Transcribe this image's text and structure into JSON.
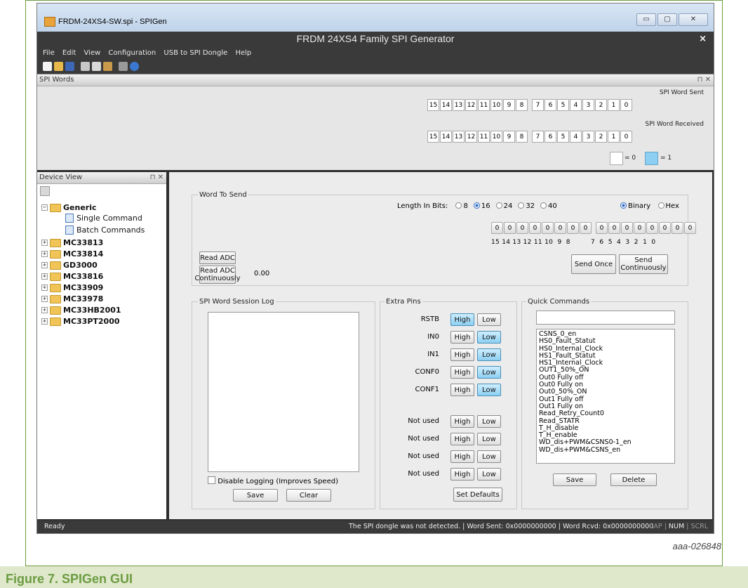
{
  "window": {
    "title": "FRDM-24XS4-SW.spi - SPIGen",
    "app_header": "FRDM 24XS4 Family SPI Generator",
    "close": "×",
    "controls": [
      "▭",
      "▢",
      "✕"
    ]
  },
  "menu": [
    "File",
    "Edit",
    "View",
    "Configuration",
    "USB to SPI Dongle",
    "Help"
  ],
  "spi_words": {
    "pane_title": "SPI Words",
    "sent_label": "SPI Word Sent",
    "received_label": "SPI Word Received",
    "bits": [
      "15",
      "14",
      "13",
      "12",
      "11",
      "10",
      "9",
      "8",
      "7",
      "6",
      "5",
      "4",
      "3",
      "2",
      "1",
      "0"
    ],
    "legend_zero": "= 0",
    "legend_one": "= 1"
  },
  "device_view": {
    "pane_title": "Device View",
    "root": "Generic",
    "children": [
      "Single Command",
      "Batch Commands"
    ],
    "devices": [
      "MC33813",
      "MC33814",
      "GD3000",
      "MC33816",
      "MC33909",
      "MC33978",
      "MC33HB2001",
      "MC33PT2000"
    ]
  },
  "word_to_send": {
    "title": "Word To Send",
    "length_label": "Length In Bits:",
    "lengths": [
      "8",
      "16",
      "24",
      "32",
      "40"
    ],
    "selected_length": "16",
    "formats": [
      "Binary",
      "Hex"
    ],
    "selected_format": "Binary",
    "bit_values": [
      "0",
      "0",
      "0",
      "0",
      "0",
      "0",
      "0",
      "0",
      "0",
      "0",
      "0",
      "0",
      "0",
      "0",
      "0",
      "0"
    ],
    "bit_labels_high": "15 14 13 12 11 10  9  8",
    "bit_labels_low": "7  6  5  4  3  2  1  0",
    "read_adc": "Read ADC",
    "read_adc_cont": "Read ADC Continuously",
    "adc_value": "0.00",
    "send_once": "Send Once",
    "send_cont": "Send Continuously"
  },
  "session_log": {
    "title": "SPI Word Session Log",
    "disable_logging": "Disable Logging (Improves Speed)",
    "save": "Save",
    "clear": "Clear"
  },
  "extra_pins": {
    "title": "Extra Pins",
    "pins": [
      {
        "name": "RSTB",
        "state": "High"
      },
      {
        "name": "IN0",
        "state": "Low"
      },
      {
        "name": "IN1",
        "state": "Low"
      },
      {
        "name": "CONF0",
        "state": "Low"
      },
      {
        "name": "CONF1",
        "state": "Low"
      },
      {
        "name": "Not used",
        "state": ""
      },
      {
        "name": "Not used",
        "state": ""
      },
      {
        "name": "Not used",
        "state": ""
      },
      {
        "name": "Not used",
        "state": ""
      }
    ],
    "high": "High",
    "low": "Low",
    "set_defaults": "Set Defaults"
  },
  "quick_commands": {
    "title": "Quick Commands",
    "items": [
      "CSNS_0_en",
      "HS0_Fault_Statut",
      "HS0_Internal_Clock",
      "HS1_Fault_Statut",
      "HS1_Internal_Clock",
      "OUT1_50%_ON",
      "Out0 Fully off",
      "Out0 Fully on",
      "Out0_50%_ON",
      "Out1 Fully off",
      "Out1 Fully on",
      "Read_Retry_Count0",
      "Read_STATR",
      "T_H_disable",
      "T_H_enable",
      "WD_dis+PWM&CSNS0-1_en",
      "WD_dis+PWM&CSNS_en"
    ],
    "save": "Save",
    "delete": "Delete"
  },
  "status": {
    "ready": "Ready",
    "message": "The SPI dongle was not detected. | Word Sent: 0x0000000000 | Word Rcvd: 0x0000000000",
    "indicators": [
      "CAP",
      "NUM",
      "SCRL"
    ]
  },
  "figure": {
    "id": "aaa-026848",
    "caption": "Figure 7. SPIGen GUI"
  },
  "colors": {
    "accent_green": "#6c9c42",
    "high_on": "#8ccff2"
  }
}
